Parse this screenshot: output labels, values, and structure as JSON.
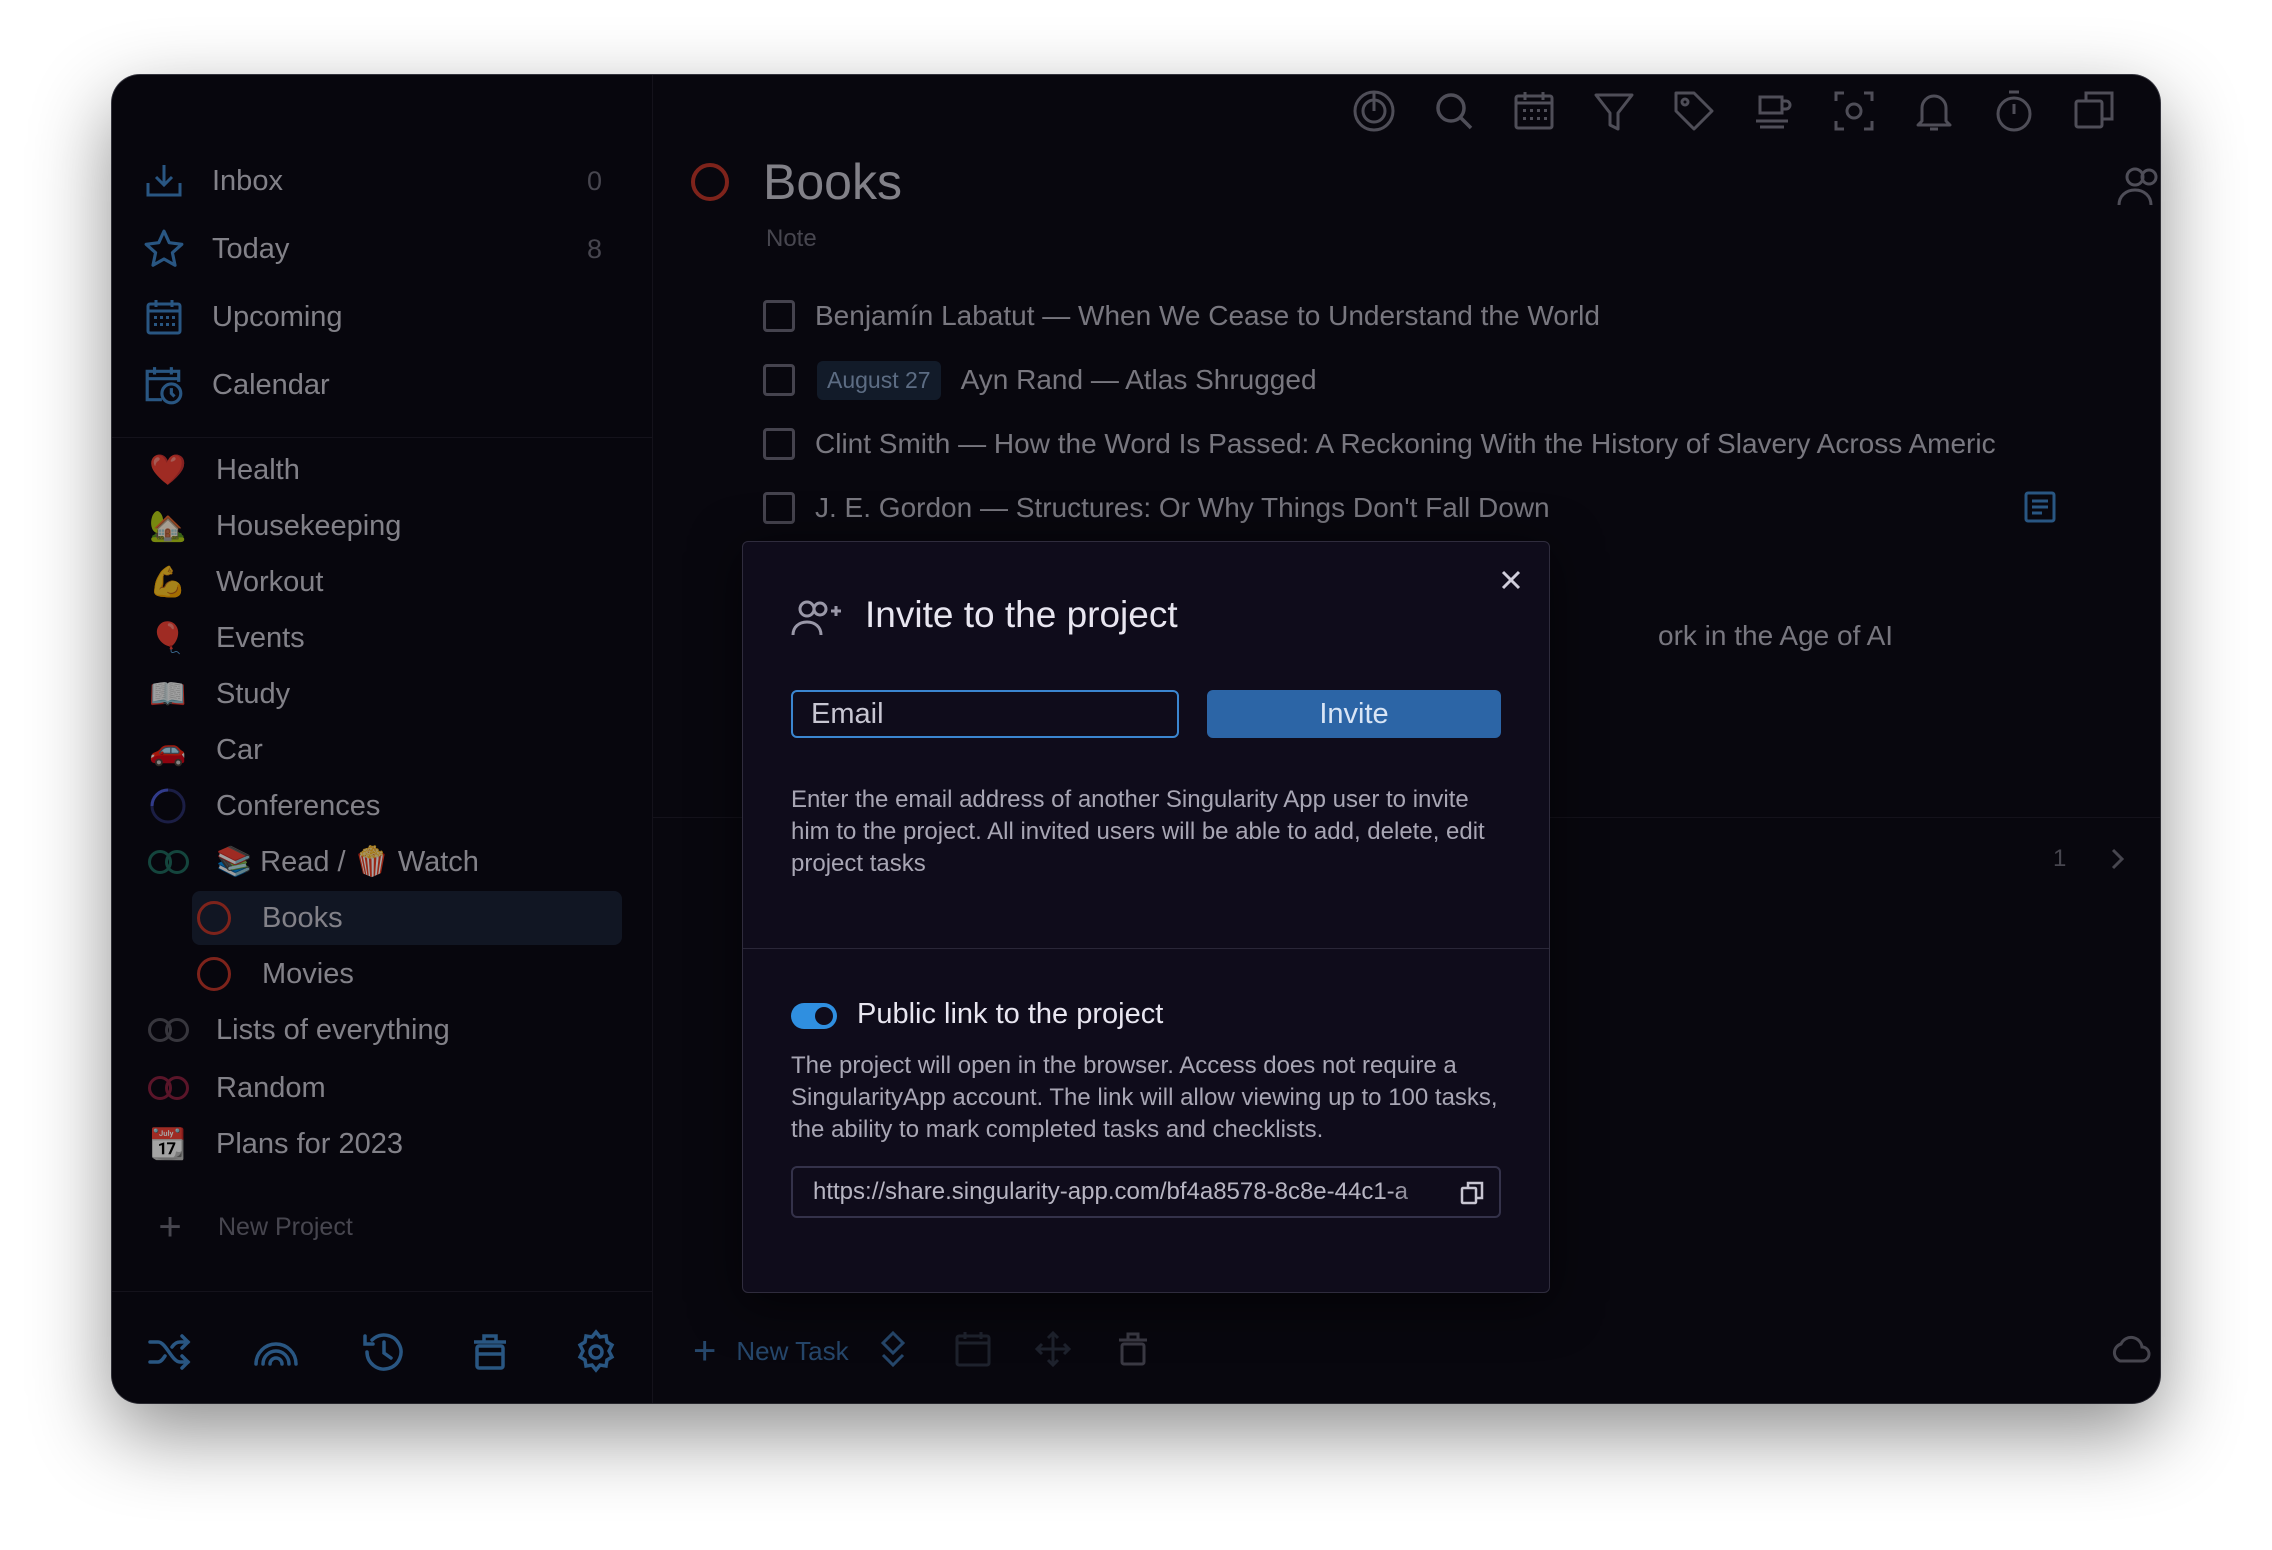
{
  "sidebar": {
    "nav": [
      {
        "label": "Inbox",
        "count": "0",
        "icon": "inbox-icon"
      },
      {
        "label": "Today",
        "count": "8",
        "icon": "star-icon"
      },
      {
        "label": "Upcoming",
        "icon": "calendar-grid-icon"
      },
      {
        "label": "Calendar",
        "icon": "calendar-clock-icon"
      }
    ],
    "projects": [
      {
        "label": "Health",
        "icon": "heart-icon"
      },
      {
        "label": "Housekeeping",
        "icon": "house-icon"
      },
      {
        "label": "Workout",
        "icon": "flexed-biceps-icon"
      },
      {
        "label": "Events",
        "icon": "balloon-icon"
      },
      {
        "label": "Study",
        "icon": "open-book-icon"
      },
      {
        "label": "Car",
        "icon": "car-icon"
      },
      {
        "label": "Conferences",
        "icon": "progress-ring-icon"
      },
      {
        "label": "📚 Read / 🍿 Watch",
        "icon": "folder-rings-icon"
      },
      {
        "label": "Books",
        "icon": "ring-icon",
        "active": true
      },
      {
        "label": "Movies",
        "icon": "ring-icon"
      },
      {
        "label": "Lists of everything",
        "icon": "folder-rings-icon"
      },
      {
        "label": "Random",
        "icon": "folder-rings-icon"
      },
      {
        "label": "Plans for 2023",
        "icon": "calendar-page-icon"
      }
    ],
    "new_project": "New Project",
    "bottom_icons": [
      "shuffle-icon",
      "rainbow-icon",
      "history-icon",
      "trash-icon",
      "gear-icon"
    ]
  },
  "toolbar": {
    "icons": [
      "focus-icon",
      "search-icon",
      "calendar-icon",
      "filter-icon",
      "tag-icon",
      "coffee-icon",
      "screenshot-icon",
      "bell-icon",
      "timer-icon",
      "copy-window-icon"
    ]
  },
  "project": {
    "title": "Books",
    "note": "Note",
    "tasks": [
      {
        "text": "Benjamín Labatut — When We Cease to Understand the World"
      },
      {
        "date": "August 27",
        "text": "Ayn Rand — Atlas Shrugged"
      },
      {
        "text": "Clint Smith — How the Word Is Passed: A Reckoning With the History of Slavery Across Americ"
      },
      {
        "text": "J. E. Gordon — Structures: Or Why Things Don't Fall Down"
      }
    ],
    "behind_fragment": "ork in the Age of AI",
    "page_number": "1"
  },
  "bottom_bar": {
    "new_task": "New Task",
    "icons": [
      "priority-icon",
      "calendar-icon",
      "move-icon",
      "trash-icon",
      "cloud-icon"
    ]
  },
  "modal": {
    "title": "Invite to the project",
    "email_placeholder": "Email",
    "invite_label": "Invite",
    "invite_description": "Enter the email address of another Singularity App user to invite him to the project. All invited users will be able to add, delete, edit project tasks",
    "public_link_title": "Public link to the project",
    "public_link_enabled": true,
    "public_link_description": "The project will open in the browser. Access does not require a SingularityApp account. The link will allow viewing up to 100 tasks, the ability to mark completed tasks and checklists.",
    "link_url": "https://share.singularity-app.com/bf4a8578-8c8e-44c1-a"
  },
  "colors": {
    "accent": "#2f8fe0",
    "button": "#2c65a6",
    "background": "#0d0b16",
    "project_ring": "#c2372a"
  }
}
